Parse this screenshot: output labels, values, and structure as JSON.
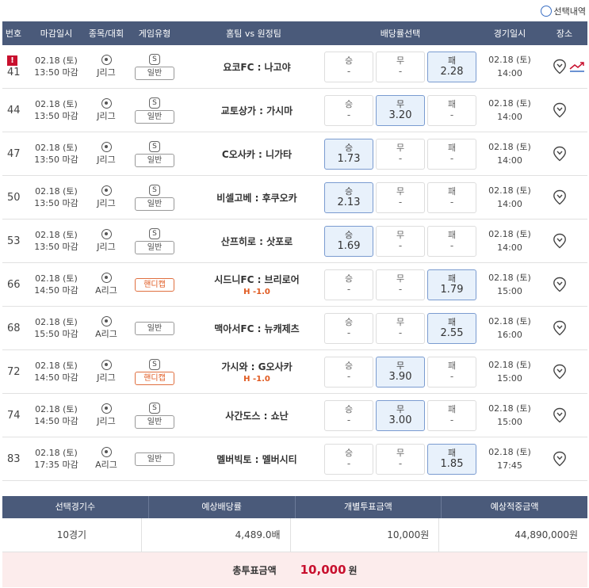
{
  "top_option": {
    "label": "선택내역"
  },
  "header": {
    "no": "번호",
    "deadline": "마감일시",
    "league": "종목/대회",
    "game_type": "게임유형",
    "teams": "홈팀 vs 원정팀",
    "odds": "배당률선택",
    "game_date": "경기일시",
    "place": "장소"
  },
  "rows": [
    {
      "no": "41",
      "warn": "!",
      "dl_date": "02.18 (토)",
      "dl_time": "13:50 마감",
      "league": "J리그",
      "s": "S",
      "type": "일반",
      "hc": false,
      "teams": "요코FC : 나고야",
      "hcap": "",
      "odds": [
        {
          "label": "승",
          "value": "-",
          "sel": false
        },
        {
          "label": "무",
          "value": "-",
          "sel": false
        },
        {
          "label": "패",
          "value": "2.28",
          "sel": true
        }
      ],
      "g_date": "02.18 (토)",
      "g_time": "14:00",
      "trend": true
    },
    {
      "no": "44",
      "warn": "",
      "dl_date": "02.18 (토)",
      "dl_time": "13:50 마감",
      "league": "J리그",
      "s": "S",
      "type": "일반",
      "hc": false,
      "teams": "교토상가 : 가시마",
      "hcap": "",
      "odds": [
        {
          "label": "승",
          "value": "-",
          "sel": false
        },
        {
          "label": "무",
          "value": "3.20",
          "sel": true
        },
        {
          "label": "패",
          "value": "-",
          "sel": false
        }
      ],
      "g_date": "02.18 (토)",
      "g_time": "14:00",
      "trend": false
    },
    {
      "no": "47",
      "warn": "",
      "dl_date": "02.18 (토)",
      "dl_time": "13:50 마감",
      "league": "J리그",
      "s": "S",
      "type": "일반",
      "hc": false,
      "teams": "C오사카 : 니가타",
      "hcap": "",
      "odds": [
        {
          "label": "승",
          "value": "1.73",
          "sel": true
        },
        {
          "label": "무",
          "value": "-",
          "sel": false
        },
        {
          "label": "패",
          "value": "-",
          "sel": false
        }
      ],
      "g_date": "02.18 (토)",
      "g_time": "14:00",
      "trend": false
    },
    {
      "no": "50",
      "warn": "",
      "dl_date": "02.18 (토)",
      "dl_time": "13:50 마감",
      "league": "J리그",
      "s": "S",
      "type": "일반",
      "hc": false,
      "teams": "비셀고베 : 후쿠오카",
      "hcap": "",
      "odds": [
        {
          "label": "승",
          "value": "2.13",
          "sel": true
        },
        {
          "label": "무",
          "value": "-",
          "sel": false
        },
        {
          "label": "패",
          "value": "-",
          "sel": false
        }
      ],
      "g_date": "02.18 (토)",
      "g_time": "14:00",
      "trend": false
    },
    {
      "no": "53",
      "warn": "",
      "dl_date": "02.18 (토)",
      "dl_time": "13:50 마감",
      "league": "J리그",
      "s": "S",
      "type": "일반",
      "hc": false,
      "teams": "산프히로 : 삿포로",
      "hcap": "",
      "odds": [
        {
          "label": "승",
          "value": "1.69",
          "sel": true
        },
        {
          "label": "무",
          "value": "-",
          "sel": false
        },
        {
          "label": "패",
          "value": "-",
          "sel": false
        }
      ],
      "g_date": "02.18 (토)",
      "g_time": "14:00",
      "trend": false
    },
    {
      "no": "66",
      "warn": "",
      "dl_date": "02.18 (토)",
      "dl_time": "14:50 마감",
      "league": "A리그",
      "s": "",
      "type": "핸디캡",
      "hc": true,
      "teams": "시드니FC : 브리로어",
      "hcap": "H -1.0",
      "odds": [
        {
          "label": "승",
          "value": "-",
          "sel": false
        },
        {
          "label": "무",
          "value": "-",
          "sel": false
        },
        {
          "label": "패",
          "value": "1.79",
          "sel": true
        }
      ],
      "g_date": "02.18 (토)",
      "g_time": "15:00",
      "trend": false
    },
    {
      "no": "68",
      "warn": "",
      "dl_date": "02.18 (토)",
      "dl_time": "15:50 마감",
      "league": "A리그",
      "s": "",
      "type": "일반",
      "hc": false,
      "teams": "맥아서FC : 뉴캐제츠",
      "hcap": "",
      "odds": [
        {
          "label": "승",
          "value": "-",
          "sel": false
        },
        {
          "label": "무",
          "value": "-",
          "sel": false
        },
        {
          "label": "패",
          "value": "2.55",
          "sel": true
        }
      ],
      "g_date": "02.18 (토)",
      "g_time": "16:00",
      "trend": false
    },
    {
      "no": "72",
      "warn": "",
      "dl_date": "02.18 (토)",
      "dl_time": "14:50 마감",
      "league": "J리그",
      "s": "S",
      "type": "핸디캡",
      "hc": true,
      "teams": "가시와 : G오사카",
      "hcap": "H -1.0",
      "odds": [
        {
          "label": "승",
          "value": "-",
          "sel": false
        },
        {
          "label": "무",
          "value": "3.90",
          "sel": true
        },
        {
          "label": "패",
          "value": "-",
          "sel": false
        }
      ],
      "g_date": "02.18 (토)",
      "g_time": "15:00",
      "trend": false
    },
    {
      "no": "74",
      "warn": "",
      "dl_date": "02.18 (토)",
      "dl_time": "14:50 마감",
      "league": "J리그",
      "s": "S",
      "type": "일반",
      "hc": false,
      "teams": "사간도스 : 쇼난",
      "hcap": "",
      "odds": [
        {
          "label": "승",
          "value": "-",
          "sel": false
        },
        {
          "label": "무",
          "value": "3.00",
          "sel": true
        },
        {
          "label": "패",
          "value": "-",
          "sel": false
        }
      ],
      "g_date": "02.18 (토)",
      "g_time": "15:00",
      "trend": false
    },
    {
      "no": "83",
      "warn": "",
      "dl_date": "02.18 (토)",
      "dl_time": "17:35 마감",
      "league": "A리그",
      "s": "",
      "type": "일반",
      "hc": false,
      "teams": "멜버빅토 : 멜버시티",
      "hcap": "",
      "odds": [
        {
          "label": "승",
          "value": "-",
          "sel": false
        },
        {
          "label": "무",
          "value": "-",
          "sel": false
        },
        {
          "label": "패",
          "value": "1.85",
          "sel": true
        }
      ],
      "g_date": "02.18 (토)",
      "g_time": "17:45",
      "trend": false
    }
  ],
  "summary": {
    "headers": [
      "선택경기수",
      "예상배당률",
      "개별투표금액",
      "예상적중금액"
    ],
    "values": [
      "10경기",
      "4,489.0배",
      "10,000원",
      "44,890,000원"
    ],
    "total_label": "총투표금액",
    "total_amount": "10,000",
    "total_unit": "원"
  },
  "colors": {
    "header_bg": "#4a5a7a",
    "selected_bg": "#e8f1fb",
    "selected_border": "#7a9bd0",
    "warn": "#c8102e",
    "handicap": "#e05a20",
    "total_bg": "#fcecec"
  }
}
